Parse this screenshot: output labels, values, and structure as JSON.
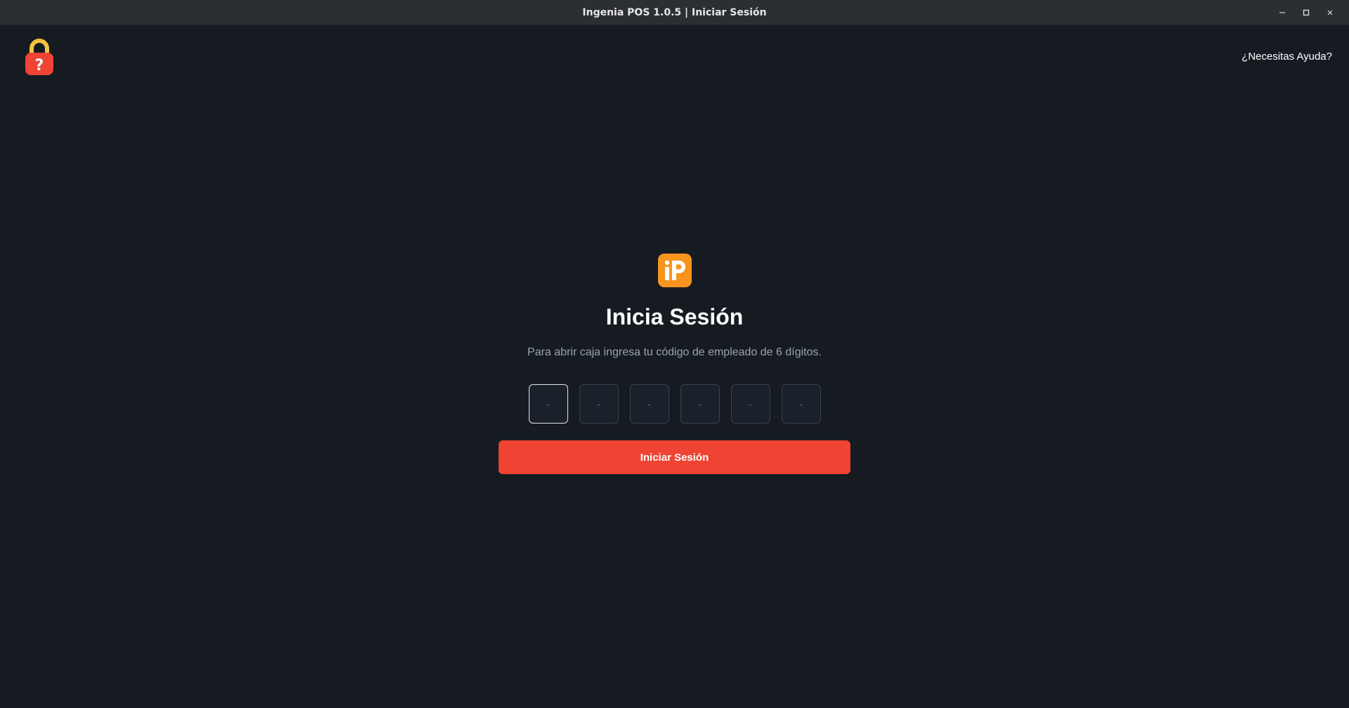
{
  "window": {
    "title": "Ingenia POS 1.0.5 | Iniciar Sesión",
    "controls": [
      "minimize-icon",
      "maximize-icon",
      "close-icon"
    ]
  },
  "header": {
    "help_icon": "lock-question-icon",
    "help_link": "¿Necesitas Ayuda?"
  },
  "login": {
    "logo_icon": "ingenia-pos-logo",
    "title": "Inicia Sesión",
    "subtitle": "Para abrir caja ingresa tu código de empleado de 6 dígitos.",
    "pin": {
      "length": 6,
      "values": [
        "",
        "",
        "",
        "",
        "",
        ""
      ],
      "placeholder": "-"
    },
    "submit_label": "Iniciar Sesión"
  },
  "colors": {
    "background": "#161b22",
    "titlebar": "#2b2e33",
    "accent": "#ef4433",
    "logo_orange": "#f7941d",
    "lock_yellow": "#f5c342",
    "lock_red": "#ef4433",
    "text_primary": "#ffffff",
    "text_secondary": "#9aa3ad"
  }
}
